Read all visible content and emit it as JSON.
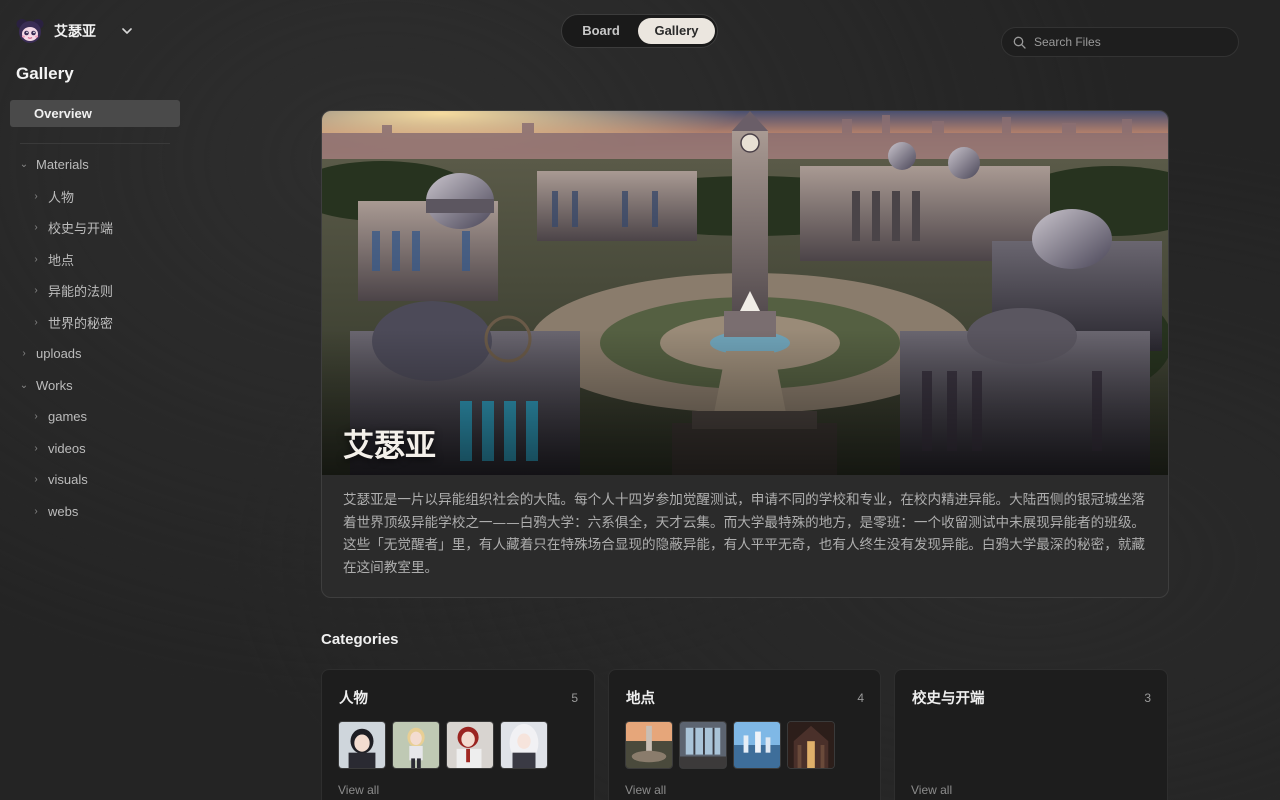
{
  "workspace": {
    "name": "艾瑟亚"
  },
  "sidebar": {
    "title": "Gallery",
    "overview_label": "Overview",
    "tree": [
      {
        "label": "Materials",
        "expanded": true,
        "level": 0
      },
      {
        "label": "人物",
        "expanded": false,
        "level": 1
      },
      {
        "label": "校史与开端",
        "expanded": false,
        "level": 1
      },
      {
        "label": "地点",
        "expanded": false,
        "level": 1
      },
      {
        "label": "异能的法则",
        "expanded": false,
        "level": 1
      },
      {
        "label": "世界的秘密",
        "expanded": false,
        "level": 1
      },
      {
        "label": "uploads",
        "expanded": false,
        "level": 0
      },
      {
        "label": "Works",
        "expanded": true,
        "level": 0
      },
      {
        "label": "games",
        "expanded": false,
        "level": 1
      },
      {
        "label": "videos",
        "expanded": false,
        "level": 1
      },
      {
        "label": "visuals",
        "expanded": false,
        "level": 1
      },
      {
        "label": "webs",
        "expanded": false,
        "level": 1
      }
    ]
  },
  "topbar": {
    "toggle": {
      "board": "Board",
      "gallery": "Gallery",
      "active": "gallery"
    },
    "search": {
      "placeholder": "Search Files",
      "value": ""
    }
  },
  "hero": {
    "title": "艾瑟亚",
    "description": "艾瑟亚是一片以异能组织社会的大陆。每个人十四岁参加觉醒测试，申请不同的学校和专业，在校内精进异能。大陆西侧的银冠城坐落着世界顶级异能学校之一——白鸦大学：六系俱全，天才云集。而大学最特殊的地方，是零班：一个收留测试中未展现异能者的班级。这些「无觉醒者」里，有人藏着只在特殊场合显现的隐蔽异能，有人平平无奇，也有人终生没有发现异能。白鸦大学最深的秘密，就藏在这间教室里。"
  },
  "categories": {
    "heading": "Categories",
    "items": [
      {
        "name": "人物",
        "count": "5",
        "view_all": "View all"
      },
      {
        "name": "地点",
        "count": "4",
        "view_all": "View all"
      },
      {
        "name": "校史与开端",
        "count": "3",
        "view_all": "View all"
      }
    ]
  },
  "colors": {
    "background": "#242424",
    "toggle_active": "#ebe6df",
    "card": "#1d1d1d",
    "overview_active": "#4a4a4a"
  }
}
